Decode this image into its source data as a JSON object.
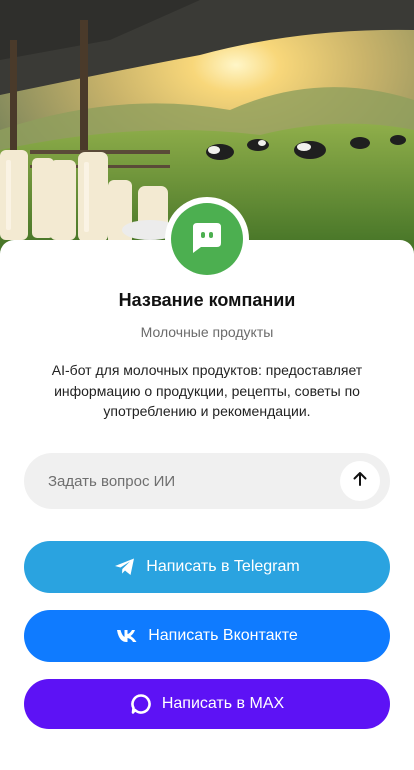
{
  "company": {
    "name": "Название компании",
    "category": "Молочные продукты",
    "description": "AI-бот для молочных продуктов: предоставляет информацию о продукции, рецепты, советы по употреблению и рекомендации."
  },
  "ask": {
    "placeholder": "Задать вопрос ИИ",
    "value": ""
  },
  "actions": {
    "telegram_label": "Написать в Telegram",
    "vk_label": "Написать Вконтакте",
    "max_label": "Написать в MAX"
  },
  "colors": {
    "avatar": "#4caf50",
    "telegram": "#2aa3e0",
    "vk": "#0f7bff",
    "max": "#5d12f5"
  },
  "icons": {
    "avatar": "chat-bot-icon",
    "send": "arrow-up-icon",
    "telegram": "telegram-icon",
    "vk": "vk-icon",
    "max": "max-icon"
  }
}
